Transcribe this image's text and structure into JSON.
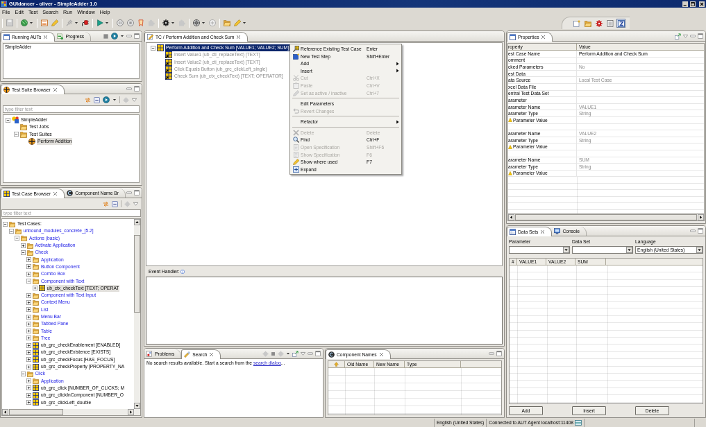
{
  "window": {
    "title": "GUIdancer - oliver - SimpleAdder 1.0"
  },
  "menu": [
    "File",
    "Edit",
    "Test",
    "Search",
    "Run",
    "Window",
    "Help"
  ],
  "perspectives": [
    {
      "selected": false
    },
    {
      "selected": false
    },
    {
      "selected": false
    },
    {
      "selected": false
    },
    {
      "selected": true
    }
  ],
  "running_auts": {
    "tabs": [
      {
        "label": "Running AUTs",
        "selected": true
      },
      {
        "label": "Progress",
        "selected": false
      }
    ],
    "items": [
      "SimpleAdder"
    ]
  },
  "test_suite_browser": {
    "tabs": [
      {
        "label": "Test Suite Browser",
        "selected": true
      }
    ],
    "filter": {
      "placeholder": "type filter text"
    },
    "tree": [
      {
        "label": "SimpleAdder",
        "kind": "project",
        "expanded": true,
        "selected": false,
        "children": [
          {
            "label": "Test Jobs",
            "kind": "folder",
            "selected": false
          },
          {
            "label": "Test Suites",
            "kind": "folder",
            "expanded": true,
            "selected": false,
            "children": [
              {
                "label": "Perform Addition",
                "kind": "suite",
                "selected": true
              }
            ]
          }
        ]
      }
    ]
  },
  "test_case_browser": {
    "tabs": [
      {
        "label": "Test Case Browser",
        "selected": true
      },
      {
        "label": "Component Name Br",
        "selected": false
      }
    ],
    "filter": {
      "placeholder": "type filter text"
    },
    "tree": [
      {
        "label": "Test Cases:",
        "kind": "root",
        "expanded": true,
        "selected": false,
        "children": [
          {
            "label": "unbound_modules_concrete_[5.2]",
            "kind": "category",
            "expanded": true,
            "selected": false,
            "children": [
              {
                "label": "Actions (basic)",
                "kind": "category",
                "expanded": true,
                "selected": false,
                "children": [
                  {
                    "label": "Activate Application",
                    "kind": "category",
                    "expanded": false,
                    "selected": false
                  },
                  {
                    "label": "Check",
                    "kind": "category",
                    "expanded": true,
                    "selected": false,
                    "children": [
                      {
                        "label": "Application",
                        "kind": "category",
                        "expanded": false,
                        "selected": false
                      },
                      {
                        "label": "Button Component",
                        "kind": "category",
                        "expanded": false,
                        "selected": false
                      },
                      {
                        "label": "Combo Box",
                        "kind": "category",
                        "expanded": false,
                        "selected": false
                      },
                      {
                        "label": "Component with Text",
                        "kind": "category",
                        "expanded": true,
                        "selected": false,
                        "children": [
                          {
                            "label": "ub_ctx_checkText [TEXT; OPERAT",
                            "kind": "test_case",
                            "expanded": false,
                            "selected": true
                          }
                        ]
                      },
                      {
                        "label": "Component with Text Input",
                        "kind": "category",
                        "expanded": false,
                        "selected": false
                      },
                      {
                        "label": "Context Menu",
                        "kind": "category",
                        "expanded": false,
                        "selected": false
                      },
                      {
                        "label": "List",
                        "kind": "category",
                        "expanded": false,
                        "selected": false
                      },
                      {
                        "label": "Menu Bar",
                        "kind": "category",
                        "expanded": false,
                        "selected": false
                      },
                      {
                        "label": "Tabbed Pane",
                        "kind": "category",
                        "expanded": false,
                        "selected": false
                      },
                      {
                        "label": "Table",
                        "kind": "category",
                        "expanded": false,
                        "selected": false
                      },
                      {
                        "label": "Tree",
                        "kind": "category",
                        "expanded": false,
                        "selected": false
                      },
                      {
                        "label": "ub_grc_checkEnablement [ENABLED]",
                        "kind": "test_case",
                        "expanded": false,
                        "selected": false
                      },
                      {
                        "label": "ub_grc_checkExistence [EXISTS]",
                        "kind": "test_case",
                        "expanded": false,
                        "selected": false
                      },
                      {
                        "label": "ub_grc_checkFocus [HAS_FOCUS]",
                        "kind": "test_case",
                        "expanded": false,
                        "selected": false
                      },
                      {
                        "label": "ub_grc_checkProperty [PROPERTY_NA",
                        "kind": "test_case",
                        "expanded": false,
                        "selected": false
                      }
                    ]
                  },
                  {
                    "label": "Click",
                    "kind": "category",
                    "expanded": true,
                    "selected": false,
                    "children": [
                      {
                        "label": "Application",
                        "kind": "category",
                        "expanded": false,
                        "selected": false
                      },
                      {
                        "label": "ub_grc_click [NUMBER_OF_CLICKS; M",
                        "kind": "test_case",
                        "expanded": false,
                        "selected": false
                      },
                      {
                        "label": "ub_grc_clickInComponent [NUMBER_O",
                        "kind": "test_case",
                        "expanded": false,
                        "selected": false
                      },
                      {
                        "label": "ub_grc_clickLeft_double",
                        "kind": "test_case",
                        "expanded": false,
                        "selected": false
                      }
                    ]
                  }
                ]
              }
            ]
          }
        ]
      }
    ]
  },
  "editor": {
    "tabs": [
      {
        "label": "TC / Perform Addition and Check Sum",
        "selected": true
      }
    ],
    "tree": [
      {
        "label": "Perform Addition and Check Sum [VALUE1; VALUE2; SUM]",
        "kind": "test_case",
        "expanded": true,
        "selected": true,
        "disabled": false,
        "children": [
          {
            "label": "Insert Value1 (ub_cti_replaceText) [TEXT]",
            "kind": "step",
            "selected": false,
            "disabled": true
          },
          {
            "label": "Insert Value2 (ub_cti_replaceText) [TEXT]",
            "kind": "step",
            "selected": false,
            "disabled": true
          },
          {
            "label": "Click Equals Button (ub_grc_clickLeft_single)",
            "kind": "step",
            "selected": false,
            "disabled": true
          },
          {
            "label": "Check Sum (ub_ctx_checkText) [TEXT; OPERATOR]",
            "kind": "step",
            "selected": false,
            "disabled": true
          }
        ]
      }
    ],
    "event_handler_label": "Event Handler:"
  },
  "context_menu": {
    "groups": [
      [
        {
          "label": "Reference Existing Test Case",
          "shortcut": "Enter",
          "disabled": false,
          "submenu": false
        },
        {
          "label": "New Test Step",
          "shortcut": "Shift+Enter",
          "disabled": false,
          "submenu": false
        },
        {
          "label": "Add",
          "disabled": false,
          "submenu": true
        },
        {
          "label": "Insert",
          "disabled": false,
          "submenu": true
        },
        {
          "label": "Cut",
          "shortcut": "Ctrl+X",
          "disabled": true,
          "submenu": false
        },
        {
          "label": "Paste",
          "shortcut": "Ctrl+V",
          "disabled": true,
          "submenu": false
        },
        {
          "label": "Set as active / inactive",
          "shortcut": "Ctrl+7",
          "disabled": true,
          "submenu": false
        }
      ],
      [
        {
          "label": "Edit Parameters",
          "disabled": false,
          "submenu": false
        },
        {
          "label": "Revert Changes",
          "disabled": true,
          "submenu": false
        }
      ],
      [
        {
          "label": "Refactor",
          "disabled": false,
          "submenu": true
        }
      ],
      [
        {
          "label": "Delete",
          "shortcut": "Delete",
          "disabled": true,
          "submenu": false
        },
        {
          "label": "Find",
          "shortcut": "Ctrl+F",
          "disabled": false,
          "submenu": false
        },
        {
          "label": "Open Specification",
          "shortcut": "Shift+F6",
          "disabled": true,
          "submenu": false
        },
        {
          "label": "Show Specification",
          "shortcut": "F6",
          "disabled": true,
          "submenu": false
        },
        {
          "label": "Show where used",
          "shortcut": "F7",
          "disabled": false,
          "submenu": false
        },
        {
          "label": "Expand",
          "disabled": false,
          "submenu": false
        }
      ]
    ]
  },
  "search_panel": {
    "tabs": [
      {
        "label": "Problems",
        "selected": false
      },
      {
        "label": "Search",
        "selected": true
      }
    ],
    "message": {
      "before": "No search results available. Start a search from the ",
      "link": "search dialog",
      "after": "..."
    }
  },
  "component_names": {
    "tabs": [
      {
        "label": "Component Names",
        "selected": true
      }
    ],
    "columns": [
      "Old Name",
      "New Name",
      "Type"
    ]
  },
  "properties": {
    "tabs": [
      {
        "label": "Properties",
        "selected": true
      }
    ],
    "columns": [
      "roperty",
      "Value"
    ],
    "rows": [
      {
        "kind": "field",
        "property": "est Case Name",
        "value": {
          "text": "Perform Addition and Check Sum",
          "disabled": false
        }
      },
      {
        "kind": "field",
        "property": "omment"
      },
      {
        "kind": "field",
        "property": "cked Parameters",
        "value": {
          "text": "No",
          "disabled": true
        }
      },
      {
        "kind": "field",
        "property": "est Data"
      },
      {
        "kind": "field",
        "property": "ata Source",
        "value": {
          "text": "Local Test Case",
          "disabled": true
        }
      },
      {
        "kind": "field",
        "property": "xcel Data File"
      },
      {
        "kind": "field",
        "property": "entral Test Data Set"
      },
      {
        "kind": "field",
        "property": "arameter"
      },
      {
        "kind": "field",
        "property": "arameter Name",
        "value": {
          "text": "VALUE1",
          "disabled": true
        }
      },
      {
        "kind": "field",
        "property": "arameter Type",
        "value": {
          "text": "String",
          "disabled": true
        }
      },
      {
        "kind": "warning",
        "property": "Parameter Value"
      },
      {
        "kind": "blank"
      },
      {
        "kind": "field",
        "property": "arameter Name",
        "value": {
          "text": "VALUE2",
          "disabled": true
        }
      },
      {
        "kind": "field",
        "property": "arameter Type",
        "value": {
          "text": "String",
          "disabled": true
        }
      },
      {
        "kind": "warning",
        "property": "Parameter Value"
      },
      {
        "kind": "blank"
      },
      {
        "kind": "field",
        "property": "arameter Name",
        "value": {
          "text": "SUM",
          "disabled": true
        }
      },
      {
        "kind": "field",
        "property": "arameter Type",
        "value": {
          "text": "String",
          "disabled": true
        }
      },
      {
        "kind": "warning",
        "property": "Parameter Value"
      }
    ]
  },
  "data_sets": {
    "tabs": [
      {
        "label": "Data Sets",
        "selected": true
      },
      {
        "label": "Console",
        "selected": false
      }
    ],
    "fields": [
      {
        "label": "Parameter"
      },
      {
        "label": "Data Set"
      },
      {
        "label": "Language",
        "value": "English (United States)"
      }
    ],
    "columns": [
      "#",
      "VALUE1",
      "VALUE2",
      "SUM"
    ],
    "buttons": [
      "Add",
      "Insert",
      "Delete"
    ]
  },
  "status_bar": {
    "language": "English (United States)",
    "connection": "Connected to AUT Agent localhost:11408"
  }
}
